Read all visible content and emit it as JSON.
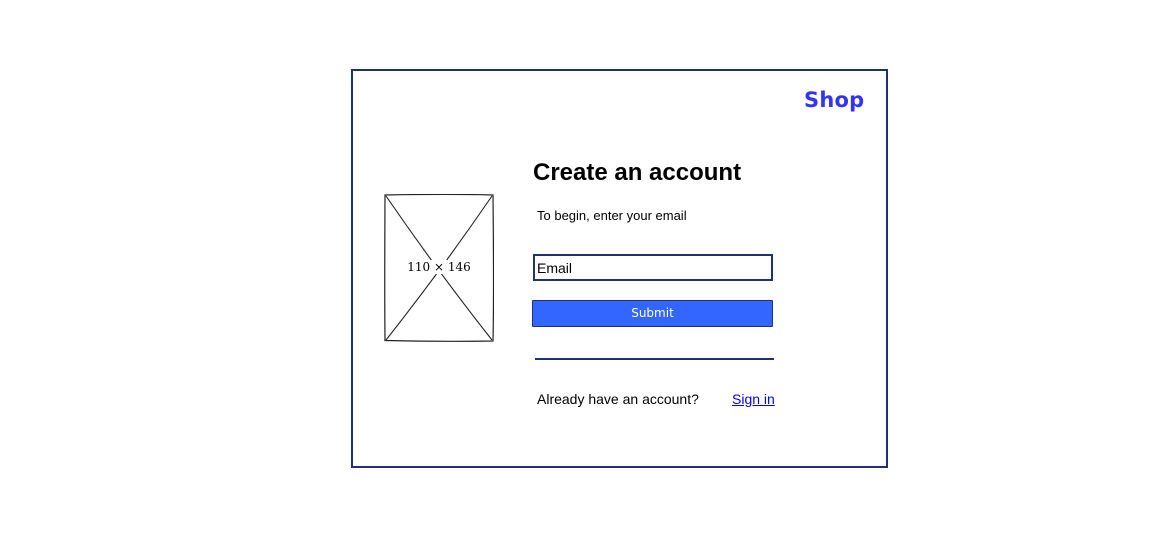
{
  "header": {
    "brand": "Shop"
  },
  "image_placeholder": {
    "label": "110 × 146",
    "icon": "image-placeholder-icon"
  },
  "form": {
    "title": "Create an account",
    "subtitle": "To begin, enter your email",
    "email_placeholder": "Email",
    "email_value": "",
    "submit_label": "Submit"
  },
  "footer": {
    "prompt": "Already have an account?",
    "signin_label": "Sign in"
  },
  "colors": {
    "brand": "#3333ff",
    "border": "#1f3175",
    "button": "#3366ff",
    "link": "#0000ee"
  }
}
